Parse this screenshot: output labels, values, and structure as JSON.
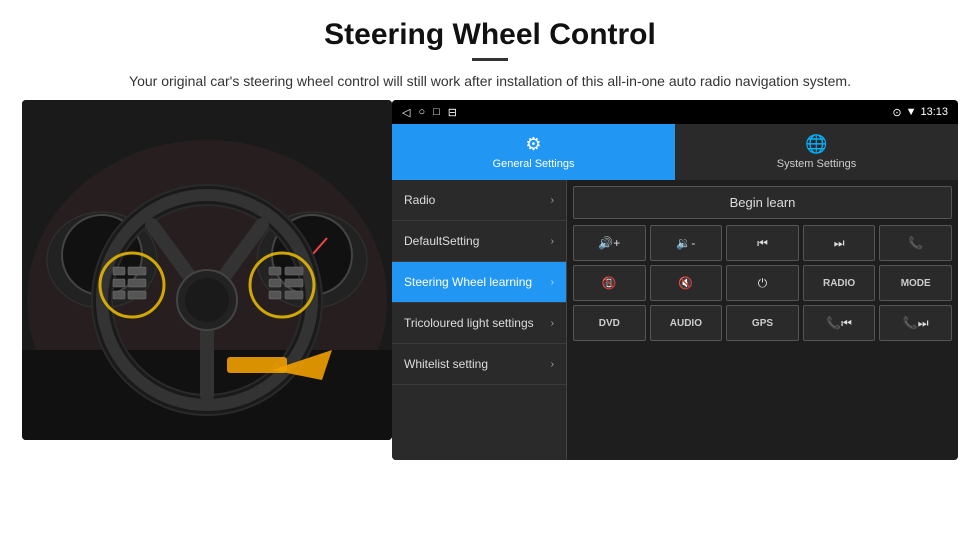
{
  "header": {
    "title": "Steering Wheel Control",
    "divider": true,
    "subtitle": "Your original car's steering wheel control will still work after installation of this all-in-one auto radio navigation system."
  },
  "tabs": [
    {
      "id": "general",
      "label": "General Settings",
      "active": true
    },
    {
      "id": "system",
      "label": "System Settings",
      "active": false
    }
  ],
  "status_bar": {
    "time": "13:13",
    "icons": [
      "◁",
      "○",
      "□",
      "⊟"
    ]
  },
  "menu_items": [
    {
      "label": "Radio",
      "active": false
    },
    {
      "label": "DefaultSetting",
      "active": false
    },
    {
      "label": "Steering Wheel learning",
      "active": true
    },
    {
      "label": "Tricoloured light settings",
      "active": false
    },
    {
      "label": "Whitelist setting",
      "active": false
    }
  ],
  "begin_learn_btn": "Begin learn",
  "controls": {
    "row1": [
      "🔊+",
      "🔊-",
      "⏮",
      "⏭",
      "📞"
    ],
    "row2": [
      "📞↩",
      "🔇",
      "⏻",
      "RADIO",
      "MODE"
    ],
    "row3": [
      "DVD",
      "AUDIO",
      "GPS",
      "📞⏮",
      "📞⏭"
    ]
  },
  "colors": {
    "accent": "#2196F3",
    "bg_dark": "#1a1a1a",
    "bg_panel": "#2a2a2a",
    "text_light": "#ddd"
  }
}
